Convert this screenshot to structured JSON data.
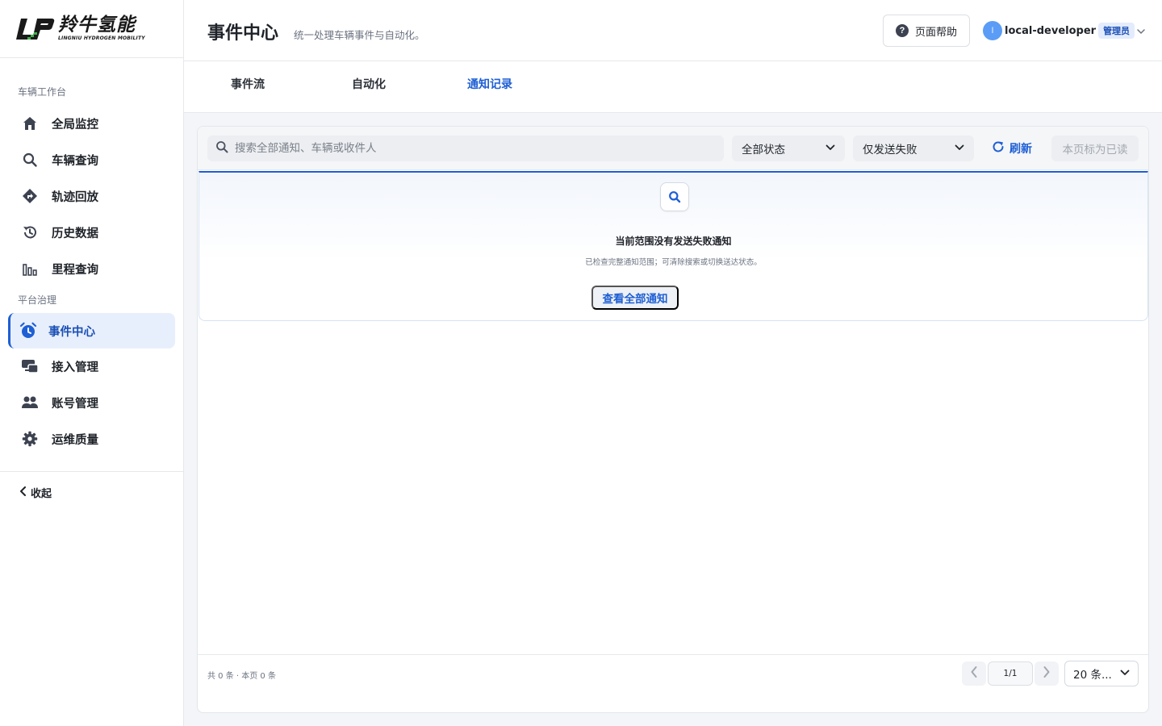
{
  "brand": {
    "name_cn": "羚牛氢能",
    "name_en": "LINGNIU HYDROGEN MOBILITY"
  },
  "sidebar": {
    "sections": [
      {
        "label": "车辆工作台"
      },
      {
        "label": "平台治理"
      }
    ],
    "items": [
      {
        "label": "全局监控",
        "icon": "home-icon"
      },
      {
        "label": "车辆查询",
        "icon": "search-icon"
      },
      {
        "label": "轨迹回放",
        "icon": "route-icon"
      },
      {
        "label": "历史数据",
        "icon": "history-icon"
      },
      {
        "label": "里程查询",
        "icon": "bar-chart-icon"
      },
      {
        "label": "事件中心",
        "icon": "alarm-clock-icon",
        "active": true
      },
      {
        "label": "接入管理",
        "icon": "device-link-icon"
      },
      {
        "label": "账号管理",
        "icon": "users-icon"
      },
      {
        "label": "运维质量",
        "icon": "gear-icon"
      }
    ],
    "collapse_label": "收起"
  },
  "header": {
    "title": "事件中心",
    "subtitle": "统一处理车辆事件与自动化。",
    "help_label": "页面帮助",
    "user": {
      "avatar_initial": "l",
      "name": "local-developer",
      "role": "管理员"
    }
  },
  "tabs": [
    {
      "label": "事件流"
    },
    {
      "label": "自动化"
    },
    {
      "label": "通知记录",
      "active": true
    }
  ],
  "toolbar": {
    "search_placeholder": "搜索全部通知、车辆或收件人",
    "status_select": "全部状态",
    "delivery_select": "仅发送失败",
    "refresh_label": "刷新",
    "mark_read_label": "本页标为已读"
  },
  "empty_state": {
    "title": "当前范围没有发送失败通知",
    "description": "已检查完整通知范围；可清除搜索或切换送达状态。",
    "action_label": "查看全部通知"
  },
  "pagination": {
    "summary": "共 0 条 · 本页 0 条",
    "current": "1/1",
    "page_size": "20 条..."
  },
  "colors": {
    "accent": "#1e5fd4",
    "active_bg": "#e8effc",
    "avatar": "#5b9cf6"
  }
}
